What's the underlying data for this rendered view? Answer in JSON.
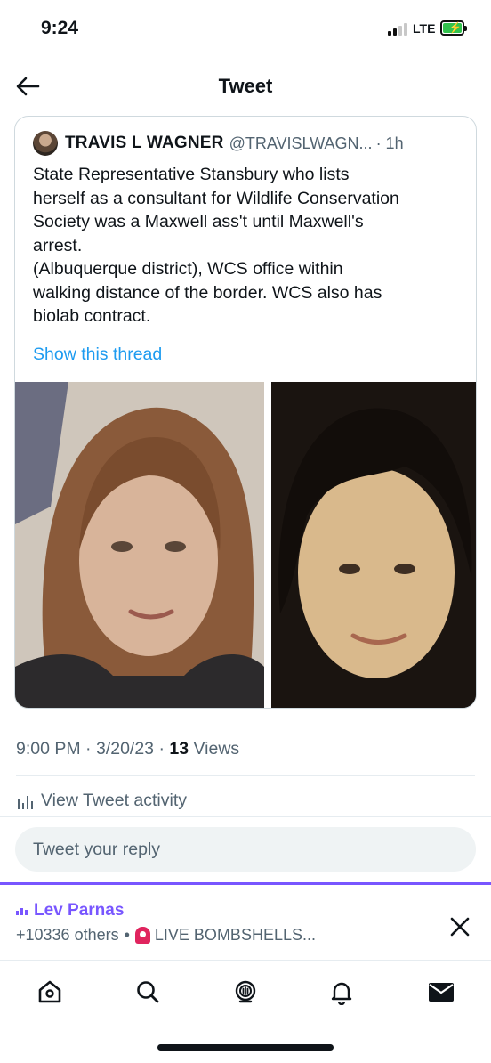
{
  "status_bar": {
    "time": "9:24",
    "network": "LTE",
    "battery_color": "#32c24d"
  },
  "header": {
    "title": "Tweet",
    "back_icon": "arrow-left-icon"
  },
  "quoted_tweet": {
    "author_name": "TRAVIS L WAGNER",
    "author_handle": "@TRAVISLWAGN...",
    "time": "· 1h",
    "text_lines": [
      "State Representative Stansbury who lists",
      "herself as a consultant for Wildlife Conservation",
      "Society was a Maxwell ass't until Maxwell's",
      "arrest.",
      "(Albuquerque district), WCS office within",
      "walking distance of the border. WCS also has",
      "biolab contract."
    ],
    "show_thread_label": "Show this thread"
  },
  "tweet_meta": {
    "time": "9:00 PM",
    "date": "3/20/23",
    "views_count": "13",
    "views_label": "Views"
  },
  "activity": {
    "label": "View Tweet activity",
    "icon": "analytics-icon"
  },
  "reply": {
    "placeholder": "Tweet your reply"
  },
  "space": {
    "host": "Lev Parnas",
    "listeners": "+10336 others",
    "separator": "•",
    "title": "LIVE BOMBSHELLS...",
    "accent": "#7856ff",
    "siren_icon": "siren-emoji-icon"
  },
  "bottom_nav": {
    "items": [
      "home-icon",
      "search-icon",
      "spaces-icon",
      "notifications-icon",
      "messages-icon"
    ]
  },
  "colors": {
    "link": "#1d9bf0",
    "secondary_text": "#536471",
    "text": "#0f1419"
  }
}
